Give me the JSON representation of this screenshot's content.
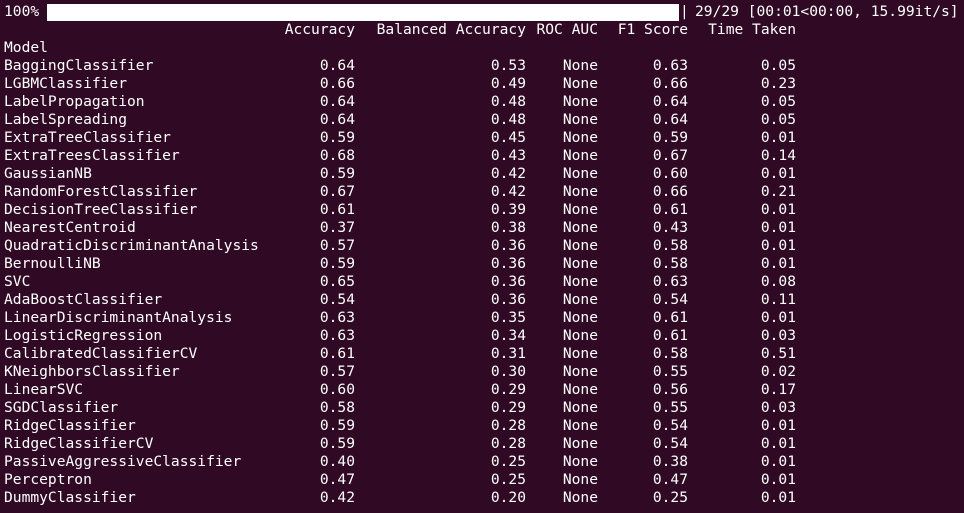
{
  "progress": {
    "percent_label": "100%",
    "fraction": 1.0,
    "separator": "|",
    "stats": "29/29 [00:01<00:00, 15.99it/s]"
  },
  "table": {
    "columns": [
      "Accuracy",
      "Balanced Accuracy",
      "ROC AUC",
      "F1 Score",
      "Time Taken"
    ],
    "index_name": "Model",
    "rows": [
      {
        "model": "BaggingClassifier",
        "accuracy": "0.64",
        "balanced_accuracy": "0.53",
        "roc_auc": "None",
        "f1": "0.63",
        "time": "0.05"
      },
      {
        "model": "LGBMClassifier",
        "accuracy": "0.66",
        "balanced_accuracy": "0.49",
        "roc_auc": "None",
        "f1": "0.66",
        "time": "0.23"
      },
      {
        "model": "LabelPropagation",
        "accuracy": "0.64",
        "balanced_accuracy": "0.48",
        "roc_auc": "None",
        "f1": "0.64",
        "time": "0.05"
      },
      {
        "model": "LabelSpreading",
        "accuracy": "0.64",
        "balanced_accuracy": "0.48",
        "roc_auc": "None",
        "f1": "0.64",
        "time": "0.05"
      },
      {
        "model": "ExtraTreeClassifier",
        "accuracy": "0.59",
        "balanced_accuracy": "0.45",
        "roc_auc": "None",
        "f1": "0.59",
        "time": "0.01"
      },
      {
        "model": "ExtraTreesClassifier",
        "accuracy": "0.68",
        "balanced_accuracy": "0.43",
        "roc_auc": "None",
        "f1": "0.67",
        "time": "0.14"
      },
      {
        "model": "GaussianNB",
        "accuracy": "0.59",
        "balanced_accuracy": "0.42",
        "roc_auc": "None",
        "f1": "0.60",
        "time": "0.01"
      },
      {
        "model": "RandomForestClassifier",
        "accuracy": "0.67",
        "balanced_accuracy": "0.42",
        "roc_auc": "None",
        "f1": "0.66",
        "time": "0.21"
      },
      {
        "model": "DecisionTreeClassifier",
        "accuracy": "0.61",
        "balanced_accuracy": "0.39",
        "roc_auc": "None",
        "f1": "0.61",
        "time": "0.01"
      },
      {
        "model": "NearestCentroid",
        "accuracy": "0.37",
        "balanced_accuracy": "0.38",
        "roc_auc": "None",
        "f1": "0.43",
        "time": "0.01"
      },
      {
        "model": "QuadraticDiscriminantAnalysis",
        "accuracy": "0.57",
        "balanced_accuracy": "0.36",
        "roc_auc": "None",
        "f1": "0.58",
        "time": "0.01"
      },
      {
        "model": "BernoulliNB",
        "accuracy": "0.59",
        "balanced_accuracy": "0.36",
        "roc_auc": "None",
        "f1": "0.58",
        "time": "0.01"
      },
      {
        "model": "SVC",
        "accuracy": "0.65",
        "balanced_accuracy": "0.36",
        "roc_auc": "None",
        "f1": "0.63",
        "time": "0.08"
      },
      {
        "model": "AdaBoostClassifier",
        "accuracy": "0.54",
        "balanced_accuracy": "0.36",
        "roc_auc": "None",
        "f1": "0.54",
        "time": "0.11"
      },
      {
        "model": "LinearDiscriminantAnalysis",
        "accuracy": "0.63",
        "balanced_accuracy": "0.35",
        "roc_auc": "None",
        "f1": "0.61",
        "time": "0.01"
      },
      {
        "model": "LogisticRegression",
        "accuracy": "0.63",
        "balanced_accuracy": "0.34",
        "roc_auc": "None",
        "f1": "0.61",
        "time": "0.03"
      },
      {
        "model": "CalibratedClassifierCV",
        "accuracy": "0.61",
        "balanced_accuracy": "0.31",
        "roc_auc": "None",
        "f1": "0.58",
        "time": "0.51"
      },
      {
        "model": "KNeighborsClassifier",
        "accuracy": "0.57",
        "balanced_accuracy": "0.30",
        "roc_auc": "None",
        "f1": "0.55",
        "time": "0.02"
      },
      {
        "model": "LinearSVC",
        "accuracy": "0.60",
        "balanced_accuracy": "0.29",
        "roc_auc": "None",
        "f1": "0.56",
        "time": "0.17"
      },
      {
        "model": "SGDClassifier",
        "accuracy": "0.58",
        "balanced_accuracy": "0.29",
        "roc_auc": "None",
        "f1": "0.55",
        "time": "0.03"
      },
      {
        "model": "RidgeClassifier",
        "accuracy": "0.59",
        "balanced_accuracy": "0.28",
        "roc_auc": "None",
        "f1": "0.54",
        "time": "0.01"
      },
      {
        "model": "RidgeClassifierCV",
        "accuracy": "0.59",
        "balanced_accuracy": "0.28",
        "roc_auc": "None",
        "f1": "0.54",
        "time": "0.01"
      },
      {
        "model": "PassiveAggressiveClassifier",
        "accuracy": "0.40",
        "balanced_accuracy": "0.25",
        "roc_auc": "None",
        "f1": "0.38",
        "time": "0.01"
      },
      {
        "model": "Perceptron",
        "accuracy": "0.47",
        "balanced_accuracy": "0.25",
        "roc_auc": "None",
        "f1": "0.47",
        "time": "0.01"
      },
      {
        "model": "DummyClassifier",
        "accuracy": "0.42",
        "balanced_accuracy": "0.20",
        "roc_auc": "None",
        "f1": "0.25",
        "time": "0.01"
      }
    ]
  },
  "colors": {
    "background": "#300a24",
    "text": "#ffffff"
  }
}
